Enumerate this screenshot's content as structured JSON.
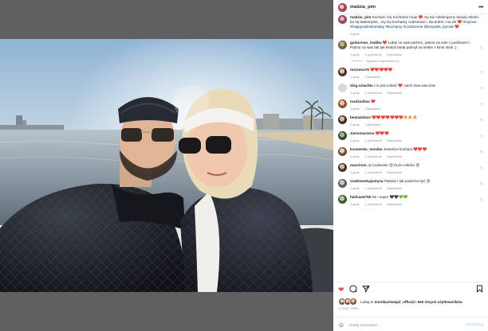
{
  "post": {
    "author": "madzia_pim",
    "menu_icon": "more-icon",
    "caption": {
      "username": "madzia_pim",
      "text_a": "Kocham Cię Kochanie moje ❤️ my nie celebrujemy swojej miłości bo są Walentynki , my się kochamy codziennie ! Na dobre i na złe ❤️ ",
      "tag_1": "#mylove",
      "tag_2": "#happyvalentinesday",
      "tag_3": "#kochamy",
      "tag_4": "#codziennie",
      "tag_5": "@krzysiek_bymak",
      "text_b": " ❤️",
      "time": "4 godz."
    },
    "comments": [
      {
        "username": "guitarman_malibu",
        "text": "❤️ Lubię na was patrzeć, patrzę na was z podziwem ! Patrzę na was tak jak kiedyś będę patrzył na siebie z kimś obok ;)",
        "time": "1 godz.",
        "likes": "1 polubienie",
        "reply": "Odpowiedz",
        "view_replies": "Wyświetl odpowiedzi (1)"
      },
      {
        "username": "marzena78",
        "text": "❤️❤️❤️❤️❤️",
        "time": "1 godz.",
        "likes": "",
        "reply": "Odpowiedz"
      },
      {
        "username": "zbig.szlachta",
        "text": "I to jest miłość ❤️ niech trwa wiecznie",
        "time": "1 godz.",
        "likes": "1 polubienie",
        "reply": "Odpowiedz"
      },
      {
        "username": "madziulilaa",
        "text": "❤️",
        "time": "1 godz.",
        "likes": "",
        "reply": "Odpowiedz"
      },
      {
        "username": "beatazelazo",
        "text": "❤️❤️❤️❤️❤️❤️❤️🔥🔥🔥",
        "time": "1 godz.",
        "likes": "",
        "reply": "Odpowiedz"
      },
      {
        "username": "ziennmarzena",
        "text": "❤️❤️❤️",
        "time": "4 godz.",
        "likes": "1 polubienie",
        "reply": "Odpowiedz"
      },
      {
        "username": "kosewska_monika",
        "text": "Jesteście kochani ❤️❤️❤️",
        "time": "4 godz.",
        "likes": "2 polubienie",
        "reply": "Odpowiedz"
      },
      {
        "username": "marcinnn_o",
        "text": "Cudownie 😍 Dużo miłości 😍",
        "time": "1 godz.",
        "likes": "1 polubienie",
        "reply": "Odpowiedz"
      },
      {
        "username": "szablowskajustyna",
        "text": "Pięknie i tak powinno być 😍",
        "time": "1 godz.",
        "likes": "1 polubienie",
        "reply": "Odpowiedz"
      },
      {
        "username": "halinaa5756",
        "text": "No i super 🖤🖤💚💚",
        "time": "1 godz.",
        "likes": "1 polubienie",
        "reply": "Odpowiedz"
      }
    ],
    "likes": {
      "prefix": "Lubią to ",
      "user": "monikachwajol_official",
      "middle": " i ",
      "others": "949 innych użytkowników"
    },
    "date": "4 GODZ. TEMU",
    "add_comment": {
      "placeholder": "Dodaj komentarz...",
      "post_label": "Opublikuj"
    },
    "photo": {
      "icons": {
        "like": "heart-filled-icon",
        "comment": "comment-icon",
        "share": "share-icon",
        "save": "bookmark-icon",
        "emoji": "emoji-icon"
      }
    }
  }
}
